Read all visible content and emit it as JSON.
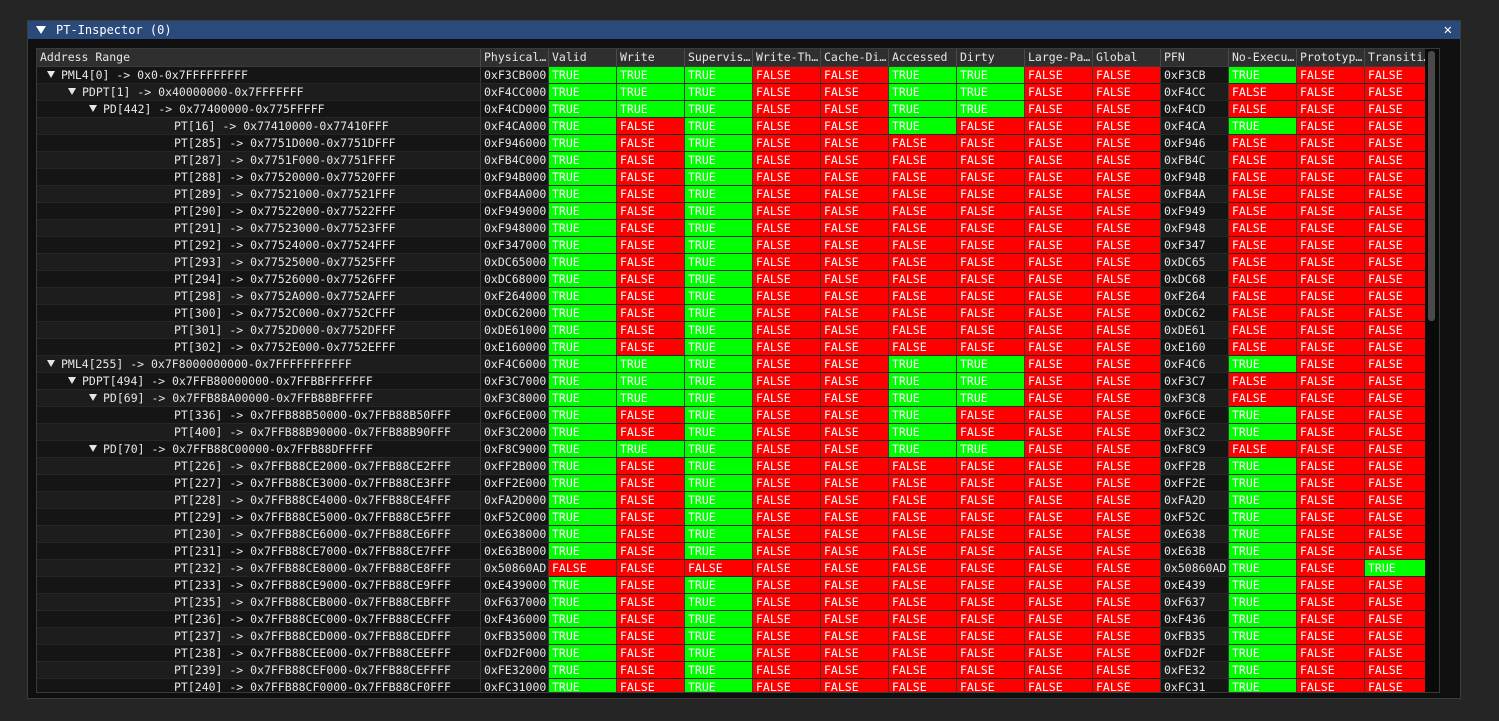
{
  "window": {
    "title": "PT-Inspector (0)",
    "close_symbol": "✕"
  },
  "columns": [
    "Address Range",
    "Physical…",
    "Valid",
    "Write",
    "Supervis…",
    "Write-Th…",
    "Cache-Di…",
    "Accessed",
    "Dirty",
    "Large-Pa…",
    "Global",
    "PFN",
    "No-Execu…",
    "Prototyp…",
    "Transiti…"
  ],
  "colors": {
    "true": "#00ff00",
    "false": "#ff0000",
    "title_bar": "#294a7a"
  },
  "rows": [
    {
      "label": "PML4[0] -> 0x0-0x7FFFFFFFFF",
      "indent": 0,
      "expandable": true,
      "phys": "0xF3CB000",
      "flags": "TTTFFTTFF",
      "pfn": "0xF3CB",
      "tail": "TFF"
    },
    {
      "label": "PDPT[1] -> 0x40000000-0x7FFFFFFF",
      "indent": 1,
      "expandable": true,
      "phys": "0xF4CC000",
      "flags": "TTTFFTTFF",
      "pfn": "0xF4CC",
      "tail": "FFF"
    },
    {
      "label": "PD[442] -> 0x77400000-0x775FFFFF",
      "indent": 2,
      "expandable": true,
      "phys": "0xF4CD000",
      "flags": "TTTFFTTFF",
      "pfn": "0xF4CD",
      "tail": "FFF"
    },
    {
      "label": "PT[16] -> 0x77410000-0x77410FFF",
      "indent": 3,
      "expandable": false,
      "phys": "0xF4CA000",
      "flags": "TFTFFTFFF",
      "pfn": "0xF4CA",
      "tail": "TFF"
    },
    {
      "label": "PT[285] -> 0x7751D000-0x7751DFFF",
      "indent": 3,
      "expandable": false,
      "phys": "0xF946000",
      "flags": "TFTFFFFFF",
      "pfn": "0xF946",
      "tail": "FFF"
    },
    {
      "label": "PT[287] -> 0x7751F000-0x7751FFFF",
      "indent": 3,
      "expandable": false,
      "phys": "0xFB4C000",
      "flags": "TFTFFFFFF",
      "pfn": "0xFB4C",
      "tail": "FFF"
    },
    {
      "label": "PT[288] -> 0x77520000-0x77520FFF",
      "indent": 3,
      "expandable": false,
      "phys": "0xF94B000",
      "flags": "TFTFFFFFF",
      "pfn": "0xF94B",
      "tail": "FFF"
    },
    {
      "label": "PT[289] -> 0x77521000-0x77521FFF",
      "indent": 3,
      "expandable": false,
      "phys": "0xFB4A000",
      "flags": "TFTFFFFFF",
      "pfn": "0xFB4A",
      "tail": "FFF"
    },
    {
      "label": "PT[290] -> 0x77522000-0x77522FFF",
      "indent": 3,
      "expandable": false,
      "phys": "0xF949000",
      "flags": "TFTFFFFFF",
      "pfn": "0xF949",
      "tail": "FFF"
    },
    {
      "label": "PT[291] -> 0x77523000-0x77523FFF",
      "indent": 3,
      "expandable": false,
      "phys": "0xF948000",
      "flags": "TFTFFFFFF",
      "pfn": "0xF948",
      "tail": "FFF"
    },
    {
      "label": "PT[292] -> 0x77524000-0x77524FFF",
      "indent": 3,
      "expandable": false,
      "phys": "0xF347000",
      "flags": "TFTFFFFFF",
      "pfn": "0xF347",
      "tail": "FFF"
    },
    {
      "label": "PT[293] -> 0x77525000-0x77525FFF",
      "indent": 3,
      "expandable": false,
      "phys": "0xDC65000",
      "flags": "TFTFFFFFF",
      "pfn": "0xDC65",
      "tail": "FFF"
    },
    {
      "label": "PT[294] -> 0x77526000-0x77526FFF",
      "indent": 3,
      "expandable": false,
      "phys": "0xDC68000",
      "flags": "TFTFFFFFF",
      "pfn": "0xDC68",
      "tail": "FFF"
    },
    {
      "label": "PT[298] -> 0x7752A000-0x7752AFFF",
      "indent": 3,
      "expandable": false,
      "phys": "0xF264000",
      "flags": "TFTFFFFFF",
      "pfn": "0xF264",
      "tail": "FFF"
    },
    {
      "label": "PT[300] -> 0x7752C000-0x7752CFFF",
      "indent": 3,
      "expandable": false,
      "phys": "0xDC62000",
      "flags": "TFTFFFFFF",
      "pfn": "0xDC62",
      "tail": "FFF"
    },
    {
      "label": "PT[301] -> 0x7752D000-0x7752DFFF",
      "indent": 3,
      "expandable": false,
      "phys": "0xDE61000",
      "flags": "TFTFFFFFF",
      "pfn": "0xDE61",
      "tail": "FFF"
    },
    {
      "label": "PT[302] -> 0x7752E000-0x7752EFFF",
      "indent": 3,
      "expandable": false,
      "phys": "0xE160000",
      "flags": "TFTFFFFFF",
      "pfn": "0xE160",
      "tail": "FFF"
    },
    {
      "label": "PML4[255] -> 0x7F8000000000-0x7FFFFFFFFFFF",
      "indent": 0,
      "expandable": true,
      "phys": "0xF4C6000",
      "flags": "TTTFFTTFF",
      "pfn": "0xF4C6",
      "tail": "TFF"
    },
    {
      "label": "PDPT[494] -> 0x7FFB80000000-0x7FFBBFFFFFFF",
      "indent": 1,
      "expandable": true,
      "phys": "0xF3C7000",
      "flags": "TTTFFTTFF",
      "pfn": "0xF3C7",
      "tail": "FFF"
    },
    {
      "label": "PD[69] -> 0x7FFB88A00000-0x7FFB88BFFFFF",
      "indent": 2,
      "expandable": true,
      "phys": "0xF3C8000",
      "flags": "TTTFFTTFF",
      "pfn": "0xF3C8",
      "tail": "FFF"
    },
    {
      "label": "PT[336] -> 0x7FFB88B50000-0x7FFB88B50FFF",
      "indent": 3,
      "expandable": false,
      "phys": "0xF6CE000",
      "flags": "TFTFFTFFF",
      "pfn": "0xF6CE",
      "tail": "TFF"
    },
    {
      "label": "PT[400] -> 0x7FFB88B90000-0x7FFB88B90FFF",
      "indent": 3,
      "expandable": false,
      "phys": "0xF3C2000",
      "flags": "TFTFFTFFF",
      "pfn": "0xF3C2",
      "tail": "TFF"
    },
    {
      "label": "PD[70] -> 0x7FFB88C00000-0x7FFB88DFFFFF",
      "indent": 2,
      "expandable": true,
      "phys": "0xF8C9000",
      "flags": "TTTFFTTFF",
      "pfn": "0xF8C9",
      "tail": "FFF"
    },
    {
      "label": "PT[226] -> 0x7FFB88CE2000-0x7FFB88CE2FFF",
      "indent": 3,
      "expandable": false,
      "phys": "0xFF2B000",
      "flags": "TFTFFFFFF",
      "pfn": "0xFF2B",
      "tail": "TFF"
    },
    {
      "label": "PT[227] -> 0x7FFB88CE3000-0x7FFB88CE3FFF",
      "indent": 3,
      "expandable": false,
      "phys": "0xFF2E000",
      "flags": "TFTFFFFFF",
      "pfn": "0xFF2E",
      "tail": "TFF"
    },
    {
      "label": "PT[228] -> 0x7FFB88CE4000-0x7FFB88CE4FFF",
      "indent": 3,
      "expandable": false,
      "phys": "0xFA2D000",
      "flags": "TFTFFFFFF",
      "pfn": "0xFA2D",
      "tail": "TFF"
    },
    {
      "label": "PT[229] -> 0x7FFB88CE5000-0x7FFB88CE5FFF",
      "indent": 3,
      "expandable": false,
      "phys": "0xF52C000",
      "flags": "TFTFFFFFF",
      "pfn": "0xF52C",
      "tail": "TFF"
    },
    {
      "label": "PT[230] -> 0x7FFB88CE6000-0x7FFB88CE6FFF",
      "indent": 3,
      "expandable": false,
      "phys": "0xE638000",
      "flags": "TFTFFFFFF",
      "pfn": "0xE638",
      "tail": "TFF"
    },
    {
      "label": "PT[231] -> 0x7FFB88CE7000-0x7FFB88CE7FFF",
      "indent": 3,
      "expandable": false,
      "phys": "0xE63B000",
      "flags": "TFTFFFFFF",
      "pfn": "0xE63B",
      "tail": "TFF"
    },
    {
      "label": "PT[232] -> 0x7FFB88CE8000-0x7FFB88CE8FFF",
      "indent": 3,
      "expandable": false,
      "phys": "0x50860AD",
      "flags": "FFFFFFFFF",
      "pfn": "0x50860AD",
      "tail": "TFT"
    },
    {
      "label": "PT[233] -> 0x7FFB88CE9000-0x7FFB88CE9FFF",
      "indent": 3,
      "expandable": false,
      "phys": "0xE439000",
      "flags": "TFTFFFFFF",
      "pfn": "0xE439",
      "tail": "TFF"
    },
    {
      "label": "PT[235] -> 0x7FFB88CEB000-0x7FFB88CEBFFF",
      "indent": 3,
      "expandable": false,
      "phys": "0xF637000",
      "flags": "TFTFFFFFF",
      "pfn": "0xF637",
      "tail": "TFF"
    },
    {
      "label": "PT[236] -> 0x7FFB88CEC000-0x7FFB88CECFFF",
      "indent": 3,
      "expandable": false,
      "phys": "0xF436000",
      "flags": "TFTFFFFFF",
      "pfn": "0xF436",
      "tail": "TFF"
    },
    {
      "label": "PT[237] -> 0x7FFB88CED000-0x7FFB88CEDFFF",
      "indent": 3,
      "expandable": false,
      "phys": "0xFB35000",
      "flags": "TFTFFFFFF",
      "pfn": "0xFB35",
      "tail": "TFF"
    },
    {
      "label": "PT[238] -> 0x7FFB88CEE000-0x7FFB88CEEFFF",
      "indent": 3,
      "expandable": false,
      "phys": "0xFD2F000",
      "flags": "TFTFFFFFF",
      "pfn": "0xFD2F",
      "tail": "TFF"
    },
    {
      "label": "PT[239] -> 0x7FFB88CEF000-0x7FFB88CEFFFF",
      "indent": 3,
      "expandable": false,
      "phys": "0xFE32000",
      "flags": "TFTFFFFFF",
      "pfn": "0xFE32",
      "tail": "TFF"
    },
    {
      "label": "PT[240] -> 0x7FFB88CF0000-0x7FFB88CF0FFF",
      "indent": 3,
      "expandable": false,
      "phys": "0xFC31000",
      "flags": "TFTFFFFFF",
      "pfn": "0xFC31",
      "tail": "TFF"
    }
  ]
}
